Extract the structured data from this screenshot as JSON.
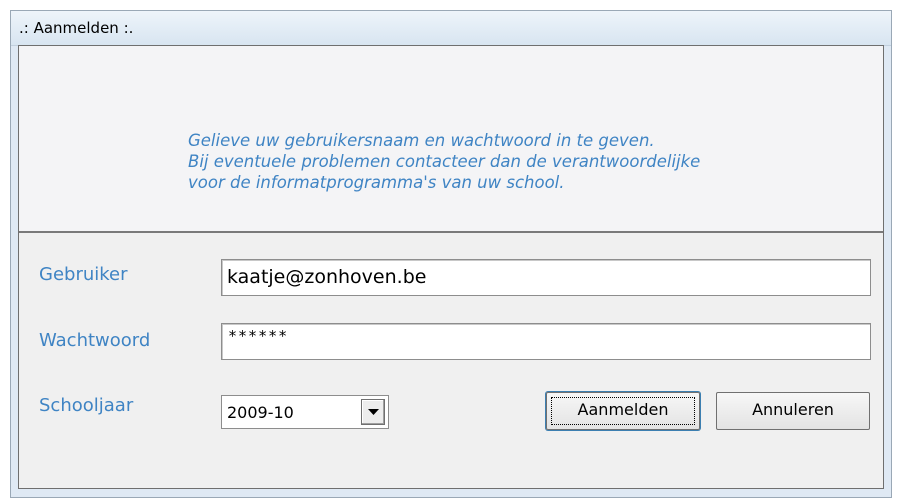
{
  "window": {
    "title": ".: Aanmelden :."
  },
  "info": {
    "lines": [
      "Gelieve uw gebruikersnaam en wachtwoord in te geven.",
      "Bij eventuele problemen contacteer dan de verantwoordelijke",
      "voor de informatprogramma's van uw school."
    ]
  },
  "form": {
    "user_label": "Gebruiker",
    "user_value": "kaatje@zonhoven.be",
    "password_label": "Wachtwoord",
    "password_value": "******",
    "year_label": "Schooljaar",
    "year_value": "2009-10"
  },
  "buttons": {
    "login": "Aanmelden",
    "cancel": "Annuleren"
  },
  "colors": {
    "label_blue": "#3f84c4"
  }
}
